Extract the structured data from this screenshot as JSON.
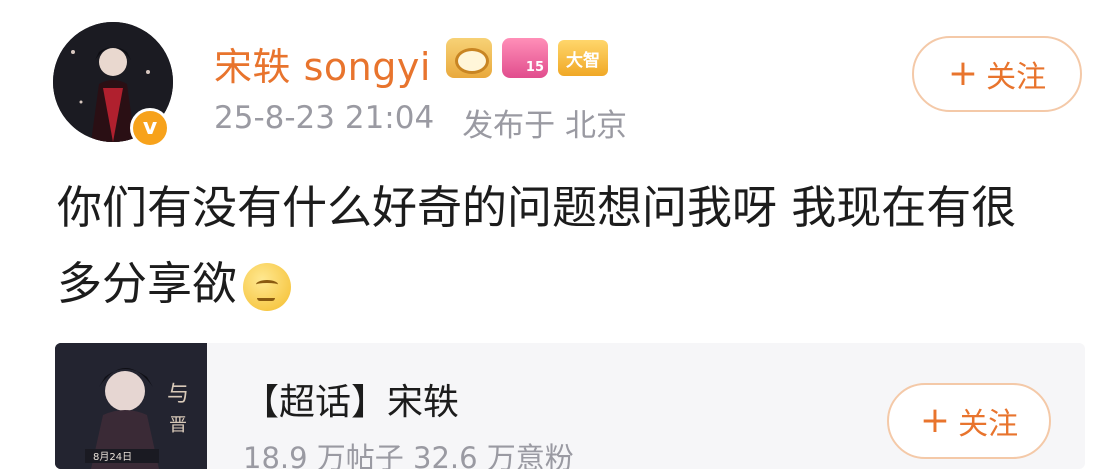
{
  "post": {
    "author": {
      "name": "宋轶 songyi",
      "verified_mark": "v",
      "badges": [
        {
          "icon": "crown-badge-icon"
        },
        {
          "icon": "diamond-level-badge-icon",
          "text": "15"
        },
        {
          "icon": "big-v-badge-icon",
          "text": "大智"
        }
      ]
    },
    "timestamp": "25-8-23 21:04",
    "location": "发布于 北京",
    "follow_button": {
      "plus": "+",
      "label": "关注"
    },
    "text_line1": "你们有没有什么好奇的问题想问我呀 我现在有很",
    "text_line2": "多分享欲",
    "emoji": "thinking-emoji-icon"
  },
  "card": {
    "title": "【超话】宋轶",
    "stats": "18.9 万帖子 32.6 万意粉",
    "follow_button": {
      "plus": "+",
      "label": "关注"
    }
  },
  "colors": {
    "accent": "#e8742d",
    "muted": "#9a9aa2",
    "text": "#1c1c1c",
    "card_bg": "#f6f6f8"
  }
}
